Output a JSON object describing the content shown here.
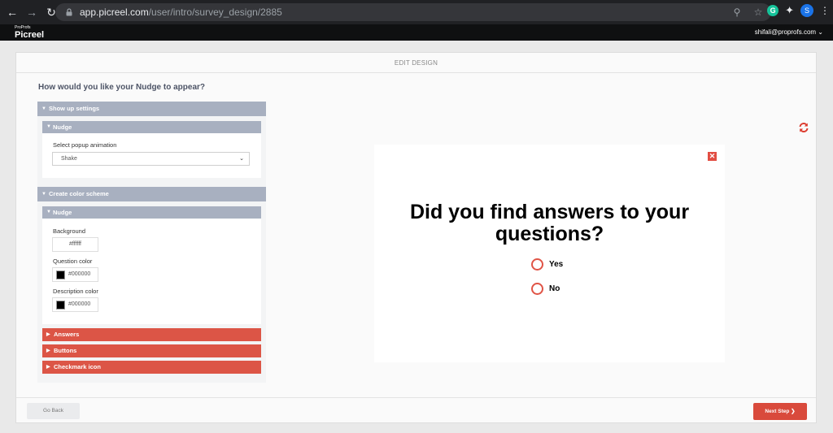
{
  "browser": {
    "url_host": "app.picreel.com",
    "url_path": "/user/intro/survey_design/2885",
    "avatar_letter": "S",
    "grammarly_letter": "G"
  },
  "app": {
    "logo_small": "ProProfs",
    "logo_big": "Picreel",
    "user_email": "shifali@proprofs.com"
  },
  "card": {
    "title": "EDIT DESIGN",
    "heading": "How would you like your Nudge to appear?"
  },
  "show_up": {
    "section_label": "Show up settings",
    "sub_label": "Nudge",
    "animation_label": "Select popup animation",
    "animation_value": "Shake"
  },
  "color_scheme": {
    "section_label": "Create color scheme",
    "sub_label": "Nudge",
    "background_label": "Background",
    "background_value": "#ffffff",
    "question_color_label": "Question color",
    "question_color_value": "#000000",
    "description_color_label": "Description color",
    "description_color_value": "#000000"
  },
  "collapsed_sections": [
    "Answers",
    "Buttons",
    "Checkmark icon"
  ],
  "preview": {
    "question": "Did you find answers to your questions?",
    "options": [
      "Yes",
      "No"
    ]
  },
  "footer": {
    "go_back": "Go Back",
    "next_step": "Next Step"
  },
  "colors": {
    "accent_red": "#dc5546",
    "section_gray": "#a8b0c0"
  }
}
